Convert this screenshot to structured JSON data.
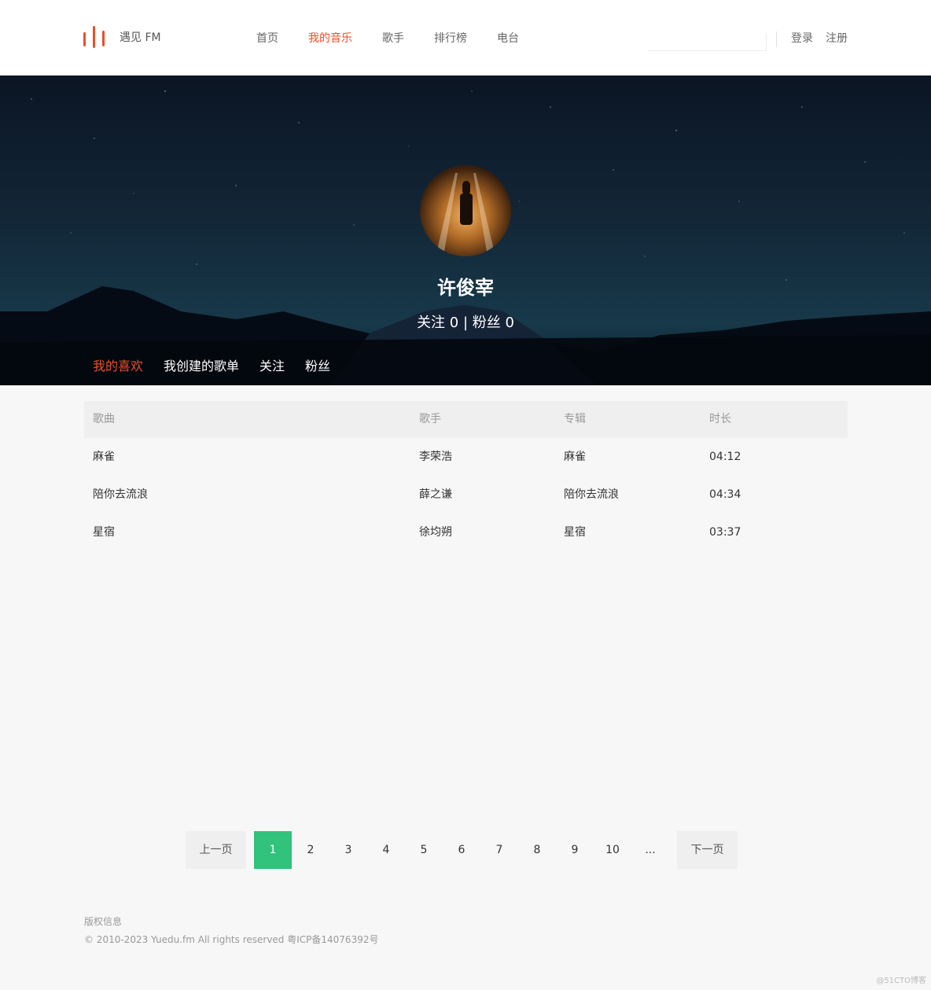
{
  "header": {
    "logo_text": "遇见 FM",
    "nav": [
      "首页",
      "我的音乐",
      "歌手",
      "排行榜",
      "电台"
    ],
    "active_nav": "我的音乐",
    "search_placeholder": "",
    "login": "登录",
    "register": "注册"
  },
  "profile": {
    "name": "许俊宰",
    "stats": "关注 0 | 粉丝 0",
    "tabs": [
      "我的喜欢",
      "我创建的歌单",
      "关注",
      "粉丝"
    ],
    "active_tab": "我的喜欢"
  },
  "table": {
    "headers": [
      "歌曲",
      "歌手",
      "专辑",
      "时长"
    ],
    "rows": [
      [
        "麻雀",
        "李荣浩",
        "麻雀",
        "04:12"
      ],
      [
        "陪你去流浪",
        "薛之谦",
        "陪你去流浪",
        "04:34"
      ],
      [
        "星宿",
        "徐均朔",
        "星宿",
        "03:37"
      ]
    ]
  },
  "pagination": {
    "prev": "上一页",
    "pages": [
      "1",
      "2",
      "3",
      "4",
      "5",
      "6",
      "7",
      "8",
      "9",
      "10",
      "..."
    ],
    "current": "1",
    "next": "下一页"
  },
  "footer": {
    "title": "版权信息",
    "copyright": "© 2010-2023 Yuedu.fm All rights reserved 粤ICP备14076392号"
  },
  "watermark": "@51CTO博客",
  "colors": {
    "accent": "#e8502b",
    "pager_active": "#31c27c"
  }
}
